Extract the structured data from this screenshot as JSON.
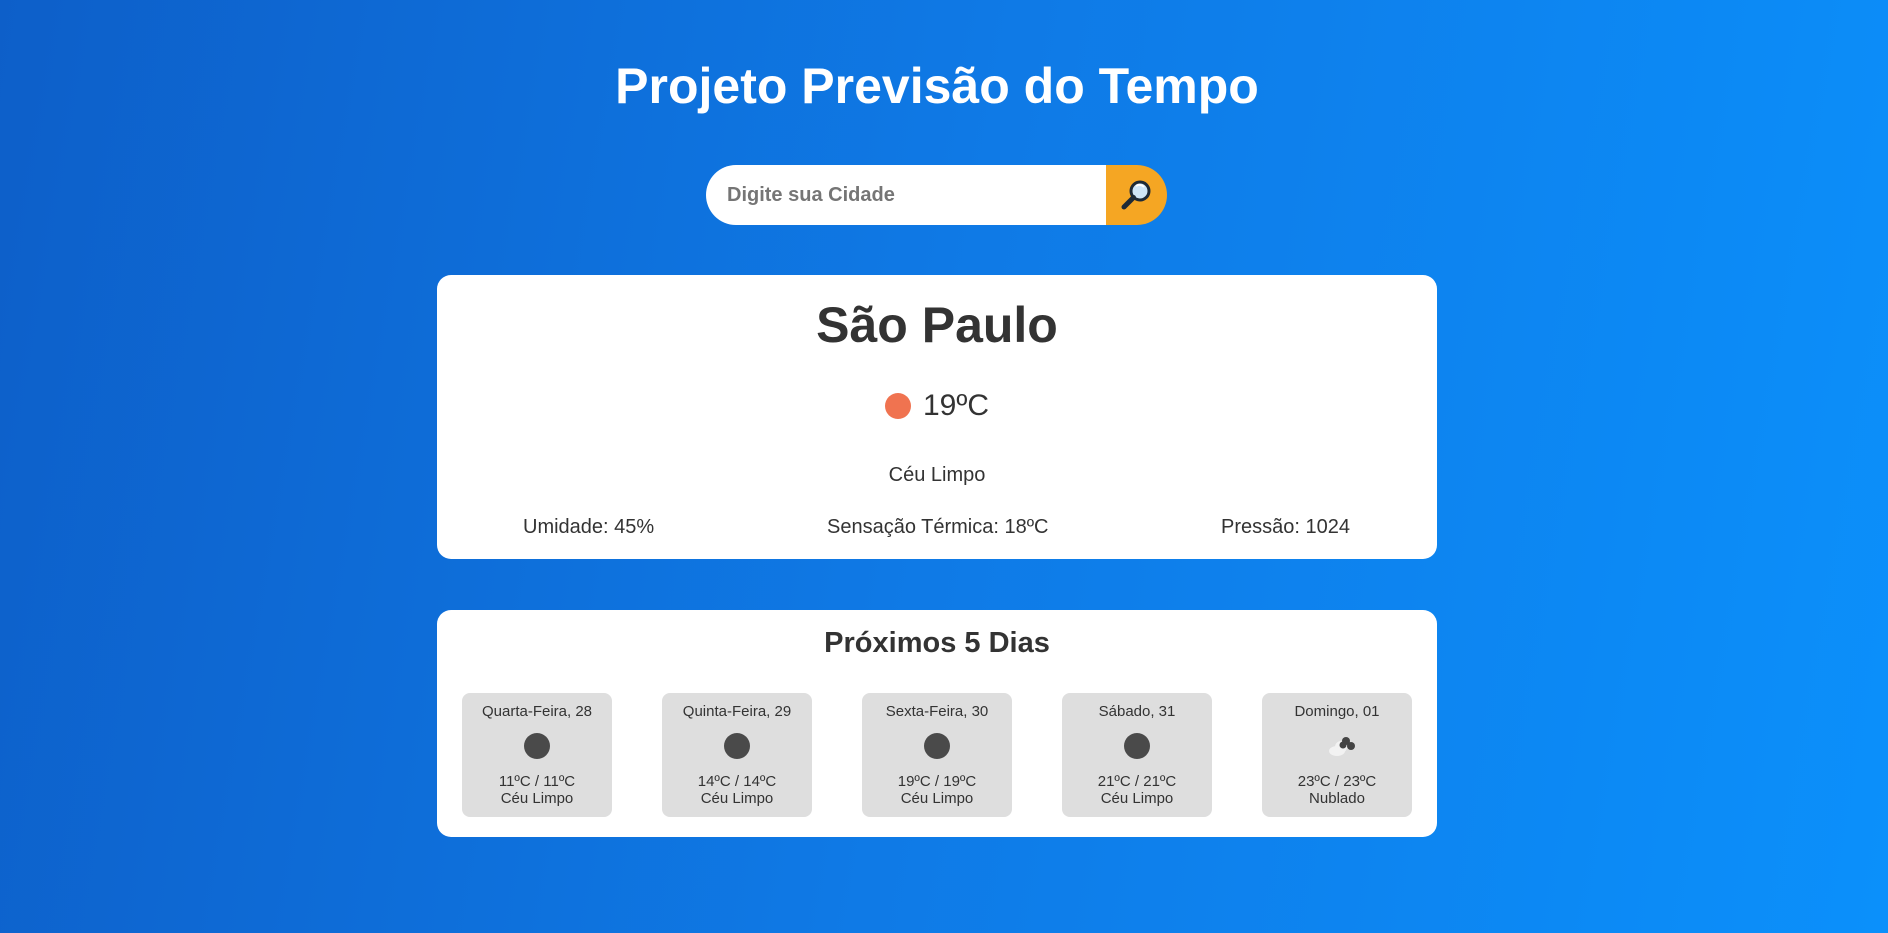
{
  "header": {
    "title": "Projeto Previsão do Tempo"
  },
  "search": {
    "placeholder": "Digite sua Cidade",
    "value": "",
    "button_icon": "magnifying-glass-icon",
    "button_color": "#f5a623"
  },
  "current": {
    "city": "São Paulo",
    "icon": "sun-icon",
    "icon_color": "#f07350",
    "temperature": "19ºC",
    "description": "Céu Limpo",
    "humidity": "Umidade: 45%",
    "feels_like": "Sensação Térmica: 18ºC",
    "pressure": "Pressão: 1024"
  },
  "forecast": {
    "title": "Próximos 5 Dias",
    "days": [
      {
        "day": "Quarta-Feira, 28",
        "icon": "clear-sky-icon",
        "temp": "11ºC / 11ºC",
        "description": "Céu Limpo"
      },
      {
        "day": "Quinta-Feira, 29",
        "icon": "clear-sky-icon",
        "temp": "14ºC / 14ºC",
        "description": "Céu Limpo"
      },
      {
        "day": "Sexta-Feira, 30",
        "icon": "clear-sky-icon",
        "temp": "19ºC / 19ºC",
        "description": "Céu Limpo"
      },
      {
        "day": "Sábado, 31",
        "icon": "clear-sky-icon",
        "temp": "21ºC / 21ºC",
        "description": "Céu Limpo"
      },
      {
        "day": "Domingo, 01",
        "icon": "cloudy-icon",
        "temp": "23ºC / 23ºC",
        "description": "Nublado"
      }
    ]
  },
  "colors": {
    "background_start": "#0d5fc9",
    "background_end": "#0b90fb",
    "card_background": "#ffffff",
    "forecast_item_background": "#dedede",
    "text": "#333333"
  }
}
